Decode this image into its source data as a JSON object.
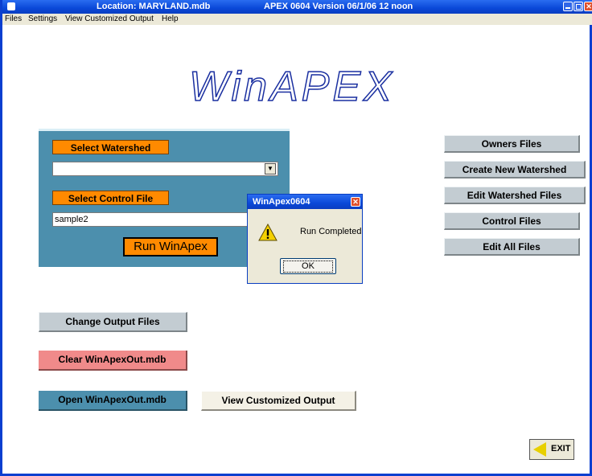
{
  "window": {
    "location_title": "Location: MARYLAND.mdb",
    "version_title": "APEX 0604 Version 06/1/06 12 noon",
    "app_icon": "app-icon",
    "controls": [
      "minimize-icon",
      "maximize-icon",
      "close-icon"
    ]
  },
  "menu": {
    "files": "Files",
    "settings": "Settings",
    "view_output": "View Customized Output",
    "help": "Help"
  },
  "logo": "WinAPEX",
  "panel": {
    "select_watershed_label": "Select Watershed",
    "watershed_value": "",
    "select_control_label": "Select Control File",
    "control_value": "sample2",
    "run_button": "Run WinApex"
  },
  "right_buttons": {
    "owners": "Owners Files",
    "create_watershed": "Create New Watershed",
    "edit_watershed": "Edit Watershed Files",
    "control_files": "Control Files",
    "edit_all": "Edit All Files"
  },
  "left_buttons": {
    "change_output": "Change Output Files",
    "clear_out": "Clear WinApexOut.mdb",
    "open_out": "Open WinApexOut.mdb",
    "view_custom": "View Customized Output"
  },
  "exit_button": {
    "label": "EXIT",
    "icon": "exit-arrow-icon"
  },
  "dialog": {
    "title": "WinApex0604",
    "message": "Run Completed",
    "ok": "OK",
    "icon": "warning-icon"
  },
  "colors": {
    "panel": "#4c8fad",
    "orange": "#ff8a00",
    "title_bar": "#0a48d8",
    "clear_button": "#f08a8a"
  }
}
